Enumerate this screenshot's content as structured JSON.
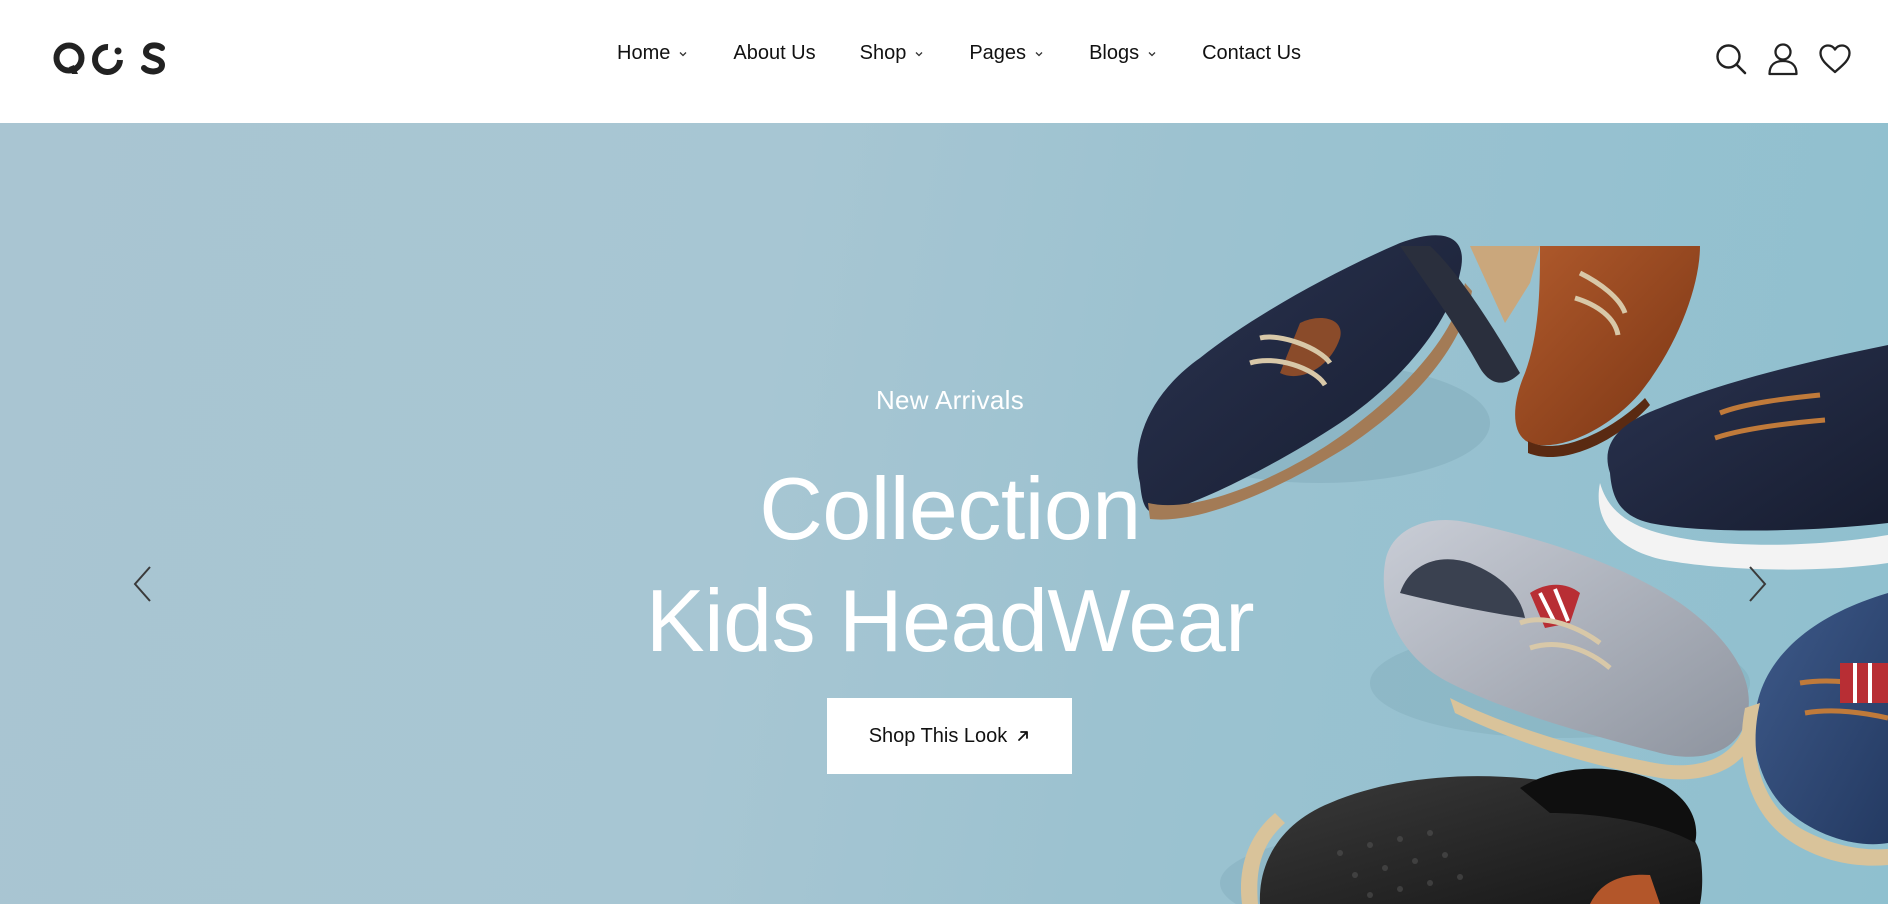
{
  "brand": {
    "logo_text": "QOS"
  },
  "nav": {
    "items": [
      {
        "label": "Home",
        "has_dropdown": true
      },
      {
        "label": "About Us",
        "has_dropdown": false
      },
      {
        "label": "Shop",
        "has_dropdown": true
      },
      {
        "label": "Pages",
        "has_dropdown": true
      },
      {
        "label": "Blogs",
        "has_dropdown": true
      },
      {
        "label": "Contact Us",
        "has_dropdown": false
      }
    ]
  },
  "header_icons": [
    "search-icon",
    "user-icon",
    "heart-icon"
  ],
  "hero": {
    "eyebrow": "New Arrivals",
    "title_line1": "Collection",
    "title_line2": "Kids HeadWear",
    "cta_label": "Shop This Look",
    "prev_icon": "chevron-left-icon",
    "next_icon": "chevron-right-icon"
  },
  "colors": {
    "hero_background": "#a7c6d3",
    "text_dark": "#111111",
    "text_light": "#ffffff",
    "button_bg": "#ffffff"
  }
}
